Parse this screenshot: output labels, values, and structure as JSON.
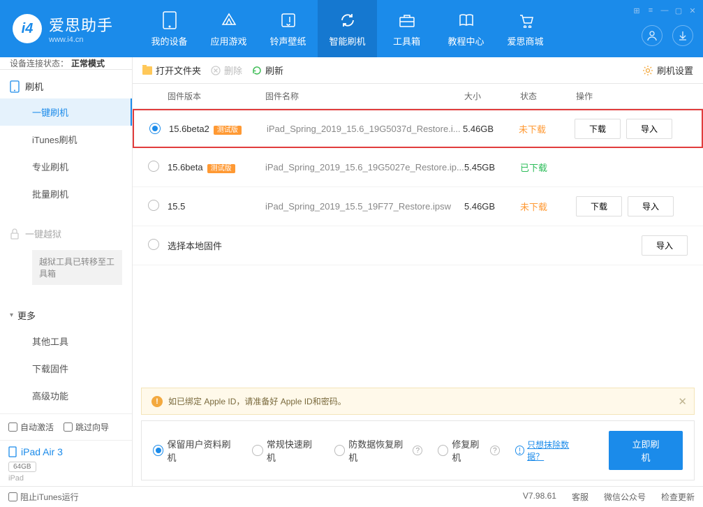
{
  "app": {
    "title": "爱思助手",
    "subtitle": "www.i4.cn"
  },
  "nav": {
    "items": [
      {
        "label": "我的设备"
      },
      {
        "label": "应用游戏"
      },
      {
        "label": "铃声壁纸"
      },
      {
        "label": "智能刷机"
      },
      {
        "label": "工具箱"
      },
      {
        "label": "教程中心"
      },
      {
        "label": "爱思商城"
      }
    ]
  },
  "sidebar": {
    "status_label": "设备连接状态：",
    "status_value": "正常模式",
    "flash_group": "刷机",
    "flash_items": [
      "一键刷机",
      "iTunes刷机",
      "专业刷机",
      "批量刷机"
    ],
    "jailbreak": "一键越狱",
    "jailbreak_note": "越狱工具已转移至工具箱",
    "more": "更多",
    "more_items": [
      "其他工具",
      "下载固件",
      "高级功能"
    ],
    "auto_activate": "自动激活",
    "skip_guide": "跳过向导",
    "device_name": "iPad Air 3",
    "device_storage": "64GB",
    "device_type": "iPad"
  },
  "toolbar": {
    "open_folder": "打开文件夹",
    "delete": "删除",
    "refresh": "刷新",
    "settings": "刷机设置"
  },
  "table": {
    "headers": {
      "version": "固件版本",
      "name": "固件名称",
      "size": "大小",
      "status": "状态",
      "actions": "操作"
    },
    "rows": [
      {
        "version": "15.6beta2",
        "beta": "测试版",
        "name": "iPad_Spring_2019_15.6_19G5037d_Restore.i...",
        "size": "5.46GB",
        "status": "未下载",
        "status_class": "not",
        "download": "下载",
        "import": "导入",
        "selected": true,
        "highlighted": true
      },
      {
        "version": "15.6beta",
        "beta": "测试版",
        "name": "iPad_Spring_2019_15.6_19G5027e_Restore.ip...",
        "size": "5.45GB",
        "status": "已下载",
        "status_class": "done",
        "selected": false
      },
      {
        "version": "15.5",
        "name": "iPad_Spring_2019_15.5_19F77_Restore.ipsw",
        "size": "5.46GB",
        "status": "未下载",
        "status_class": "not",
        "download": "下载",
        "import": "导入",
        "selected": false
      },
      {
        "version": "",
        "name_in_version": "选择本地固件",
        "import": "导入",
        "selected": false
      }
    ]
  },
  "banner": {
    "text": "如已绑定 Apple ID，请准备好 Apple ID和密码。"
  },
  "options": {
    "opt1": "保留用户资料刷机",
    "opt2": "常规快速刷机",
    "opt3": "防数据恢复刷机",
    "opt4": "修复刷机",
    "link": "只想抹除数据？",
    "action": "立即刷机"
  },
  "footer": {
    "block_itunes": "阻止iTunes运行",
    "version": "V7.98.61",
    "support": "客服",
    "wechat": "微信公众号",
    "update": "检查更新"
  }
}
